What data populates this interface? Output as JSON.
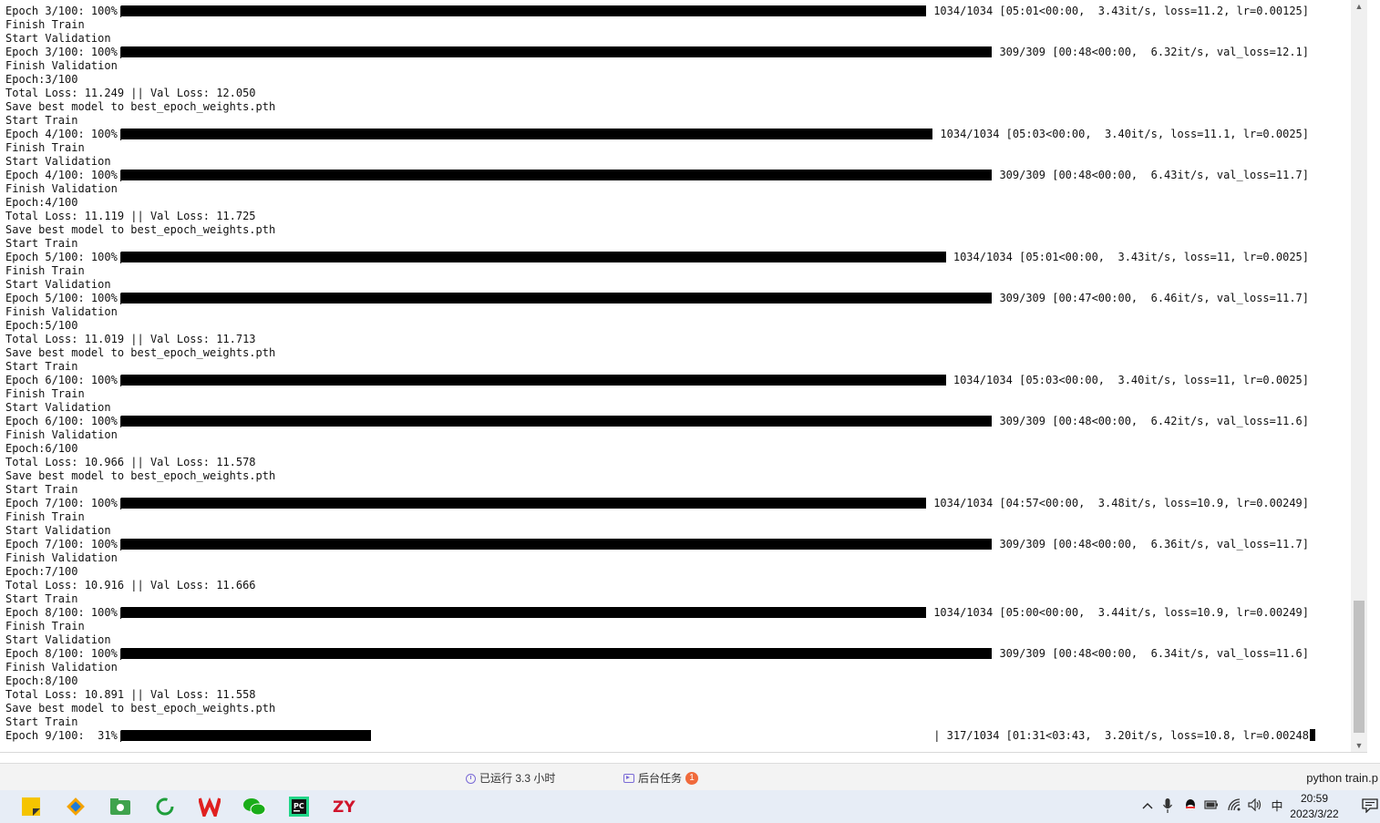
{
  "terminal": {
    "lines": [
      {
        "kind": "bar",
        "prefix": "Epoch 3/100: 100%|",
        "fill": 1.0,
        "suffix": "1034/1034 [05:01<00:00,  3.43it/s, loss=11.2, lr=0.00125]"
      },
      {
        "kind": "text",
        "text": "Finish Train"
      },
      {
        "kind": "text",
        "text": "Start Validation"
      },
      {
        "kind": "bar",
        "prefix": "Epoch 3/100: 100%|",
        "fill": 1.0,
        "suffix": "309/309 [00:48<00:00,  6.32it/s, val_loss=12.1]"
      },
      {
        "kind": "text",
        "text": "Finish Validation"
      },
      {
        "kind": "text",
        "text": "Epoch:3/100"
      },
      {
        "kind": "text",
        "text": "Total Loss: 11.249 || Val Loss: 12.050"
      },
      {
        "kind": "text",
        "text": "Save best model to best_epoch_weights.pth"
      },
      {
        "kind": "text",
        "text": "Start Train"
      },
      {
        "kind": "bar",
        "prefix": "Epoch 4/100: 100%|",
        "fill": 1.0,
        "suffix": "1034/1034 [05:03<00:00,  3.40it/s, loss=11.1, lr=0.0025]"
      },
      {
        "kind": "text",
        "text": "Finish Train"
      },
      {
        "kind": "text",
        "text": "Start Validation"
      },
      {
        "kind": "bar",
        "prefix": "Epoch 4/100: 100%|",
        "fill": 1.0,
        "suffix": "309/309 [00:48<00:00,  6.43it/s, val_loss=11.7]"
      },
      {
        "kind": "text",
        "text": "Finish Validation"
      },
      {
        "kind": "text",
        "text": "Epoch:4/100"
      },
      {
        "kind": "text",
        "text": "Total Loss: 11.119 || Val Loss: 11.725"
      },
      {
        "kind": "text",
        "text": "Save best model to best_epoch_weights.pth"
      },
      {
        "kind": "text",
        "text": "Start Train"
      },
      {
        "kind": "bar",
        "prefix": "Epoch 5/100: 100%|",
        "fill": 1.0,
        "suffix": "1034/1034 [05:01<00:00,  3.43it/s, loss=11, lr=0.0025]"
      },
      {
        "kind": "text",
        "text": "Finish Train"
      },
      {
        "kind": "text",
        "text": "Start Validation"
      },
      {
        "kind": "bar",
        "prefix": "Epoch 5/100: 100%|",
        "fill": 1.0,
        "suffix": "309/309 [00:47<00:00,  6.46it/s, val_loss=11.7]"
      },
      {
        "kind": "text",
        "text": "Finish Validation"
      },
      {
        "kind": "text",
        "text": "Epoch:5/100"
      },
      {
        "kind": "text",
        "text": "Total Loss: 11.019 || Val Loss: 11.713"
      },
      {
        "kind": "text",
        "text": "Save best model to best_epoch_weights.pth"
      },
      {
        "kind": "text",
        "text": "Start Train"
      },
      {
        "kind": "bar",
        "prefix": "Epoch 6/100: 100%|",
        "fill": 1.0,
        "suffix": "1034/1034 [05:03<00:00,  3.40it/s, loss=11, lr=0.0025]"
      },
      {
        "kind": "text",
        "text": "Finish Train"
      },
      {
        "kind": "text",
        "text": "Start Validation"
      },
      {
        "kind": "bar",
        "prefix": "Epoch 6/100: 100%|",
        "fill": 1.0,
        "suffix": "309/309 [00:48<00:00,  6.42it/s, val_loss=11.6]"
      },
      {
        "kind": "text",
        "text": "Finish Validation"
      },
      {
        "kind": "text",
        "text": "Epoch:6/100"
      },
      {
        "kind": "text",
        "text": "Total Loss: 10.966 || Val Loss: 11.578"
      },
      {
        "kind": "text",
        "text": "Save best model to best_epoch_weights.pth"
      },
      {
        "kind": "text",
        "text": "Start Train"
      },
      {
        "kind": "bar",
        "prefix": "Epoch 7/100: 100%|",
        "fill": 1.0,
        "suffix": "1034/1034 [04:57<00:00,  3.48it/s, loss=10.9, lr=0.00249]"
      },
      {
        "kind": "text",
        "text": "Finish Train"
      },
      {
        "kind": "text",
        "text": "Start Validation"
      },
      {
        "kind": "bar",
        "prefix": "Epoch 7/100: 100%|",
        "fill": 1.0,
        "suffix": "309/309 [00:48<00:00,  6.36it/s, val_loss=11.7]"
      },
      {
        "kind": "text",
        "text": "Finish Validation"
      },
      {
        "kind": "text",
        "text": "Epoch:7/100"
      },
      {
        "kind": "text",
        "text": "Total Loss: 10.916 || Val Loss: 11.666"
      },
      {
        "kind": "text",
        "text": "Start Train"
      },
      {
        "kind": "bar",
        "prefix": "Epoch 8/100: 100%|",
        "fill": 1.0,
        "suffix": "1034/1034 [05:00<00:00,  3.44it/s, loss=10.9, lr=0.00249]"
      },
      {
        "kind": "text",
        "text": "Finish Train"
      },
      {
        "kind": "text",
        "text": "Start Validation"
      },
      {
        "kind": "bar",
        "prefix": "Epoch 8/100: 100%|",
        "fill": 1.0,
        "suffix": "309/309 [00:48<00:00,  6.34it/s, val_loss=11.6]"
      },
      {
        "kind": "text",
        "text": "Finish Validation"
      },
      {
        "kind": "text",
        "text": "Epoch:8/100"
      },
      {
        "kind": "text",
        "text": "Total Loss: 10.891 || Val Loss: 11.558"
      },
      {
        "kind": "text",
        "text": "Save best model to best_epoch_weights.pth"
      },
      {
        "kind": "text",
        "text": "Start Train"
      },
      {
        "kind": "bar",
        "prefix": "Epoch 9/100:  31%|",
        "fill": 0.31,
        "suffix": "| 317/1034 [01:31<03:43,  3.20it/s, loss=10.8, lr=0.00248",
        "cursor": true
      }
    ]
  },
  "statusbar": {
    "running": "已运行 3.3 小时",
    "tasks": "后台任务",
    "tasks_count": "1",
    "command": "python train.p"
  },
  "taskbar": {
    "apps": [
      {
        "name": "sticky-notes-icon",
        "color": "#f5c400"
      },
      {
        "name": "git-icon",
        "color": "#e24329"
      },
      {
        "name": "file-manager-icon",
        "color": "#3fa34d"
      },
      {
        "name": "refresh-ring-icon",
        "color": "#1e9e3a"
      },
      {
        "name": "wps-office-icon",
        "color": "#e02020"
      },
      {
        "name": "wechat-icon",
        "color": "#1aad19"
      },
      {
        "name": "pycharm-icon",
        "color": "#111111"
      },
      {
        "name": "zy-app-icon",
        "color": "#d0142c"
      }
    ],
    "tray": {
      "chevron": "^",
      "ime": "中"
    },
    "time": "20:59",
    "date": "2023/3/22"
  }
}
